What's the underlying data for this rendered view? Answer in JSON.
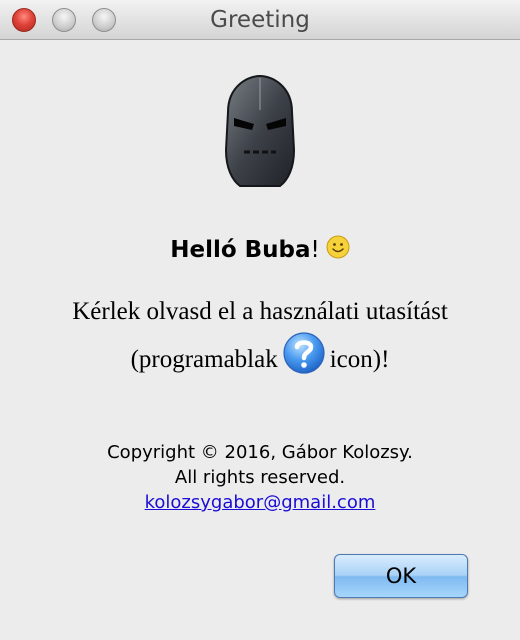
{
  "window": {
    "title": "Greeting",
    "controls": [
      "close",
      "minimize",
      "maximize"
    ]
  },
  "logo": {
    "icon": "iron-helmet-icon"
  },
  "greeting": {
    "prefix": "Helló ",
    "name": "Buba",
    "suffix": "!",
    "emoji_icon": "smiley-icon"
  },
  "instructions": {
    "line1": "Kérlek olvasd el a használati utasítást",
    "line2_before": "(programablak",
    "line2_after": "icon)!",
    "icon": "help-question-icon"
  },
  "copyright": {
    "line1": "Copyright © 2016, Gábor Kolozsy.",
    "line2": "All rights reserved.",
    "email": "kolozsygabor@gmail.com"
  },
  "ok_button": {
    "label": "OK"
  },
  "colors": {
    "accent": "#a9d2f6",
    "link": "#1a0dd6",
    "background": "#ececec"
  }
}
